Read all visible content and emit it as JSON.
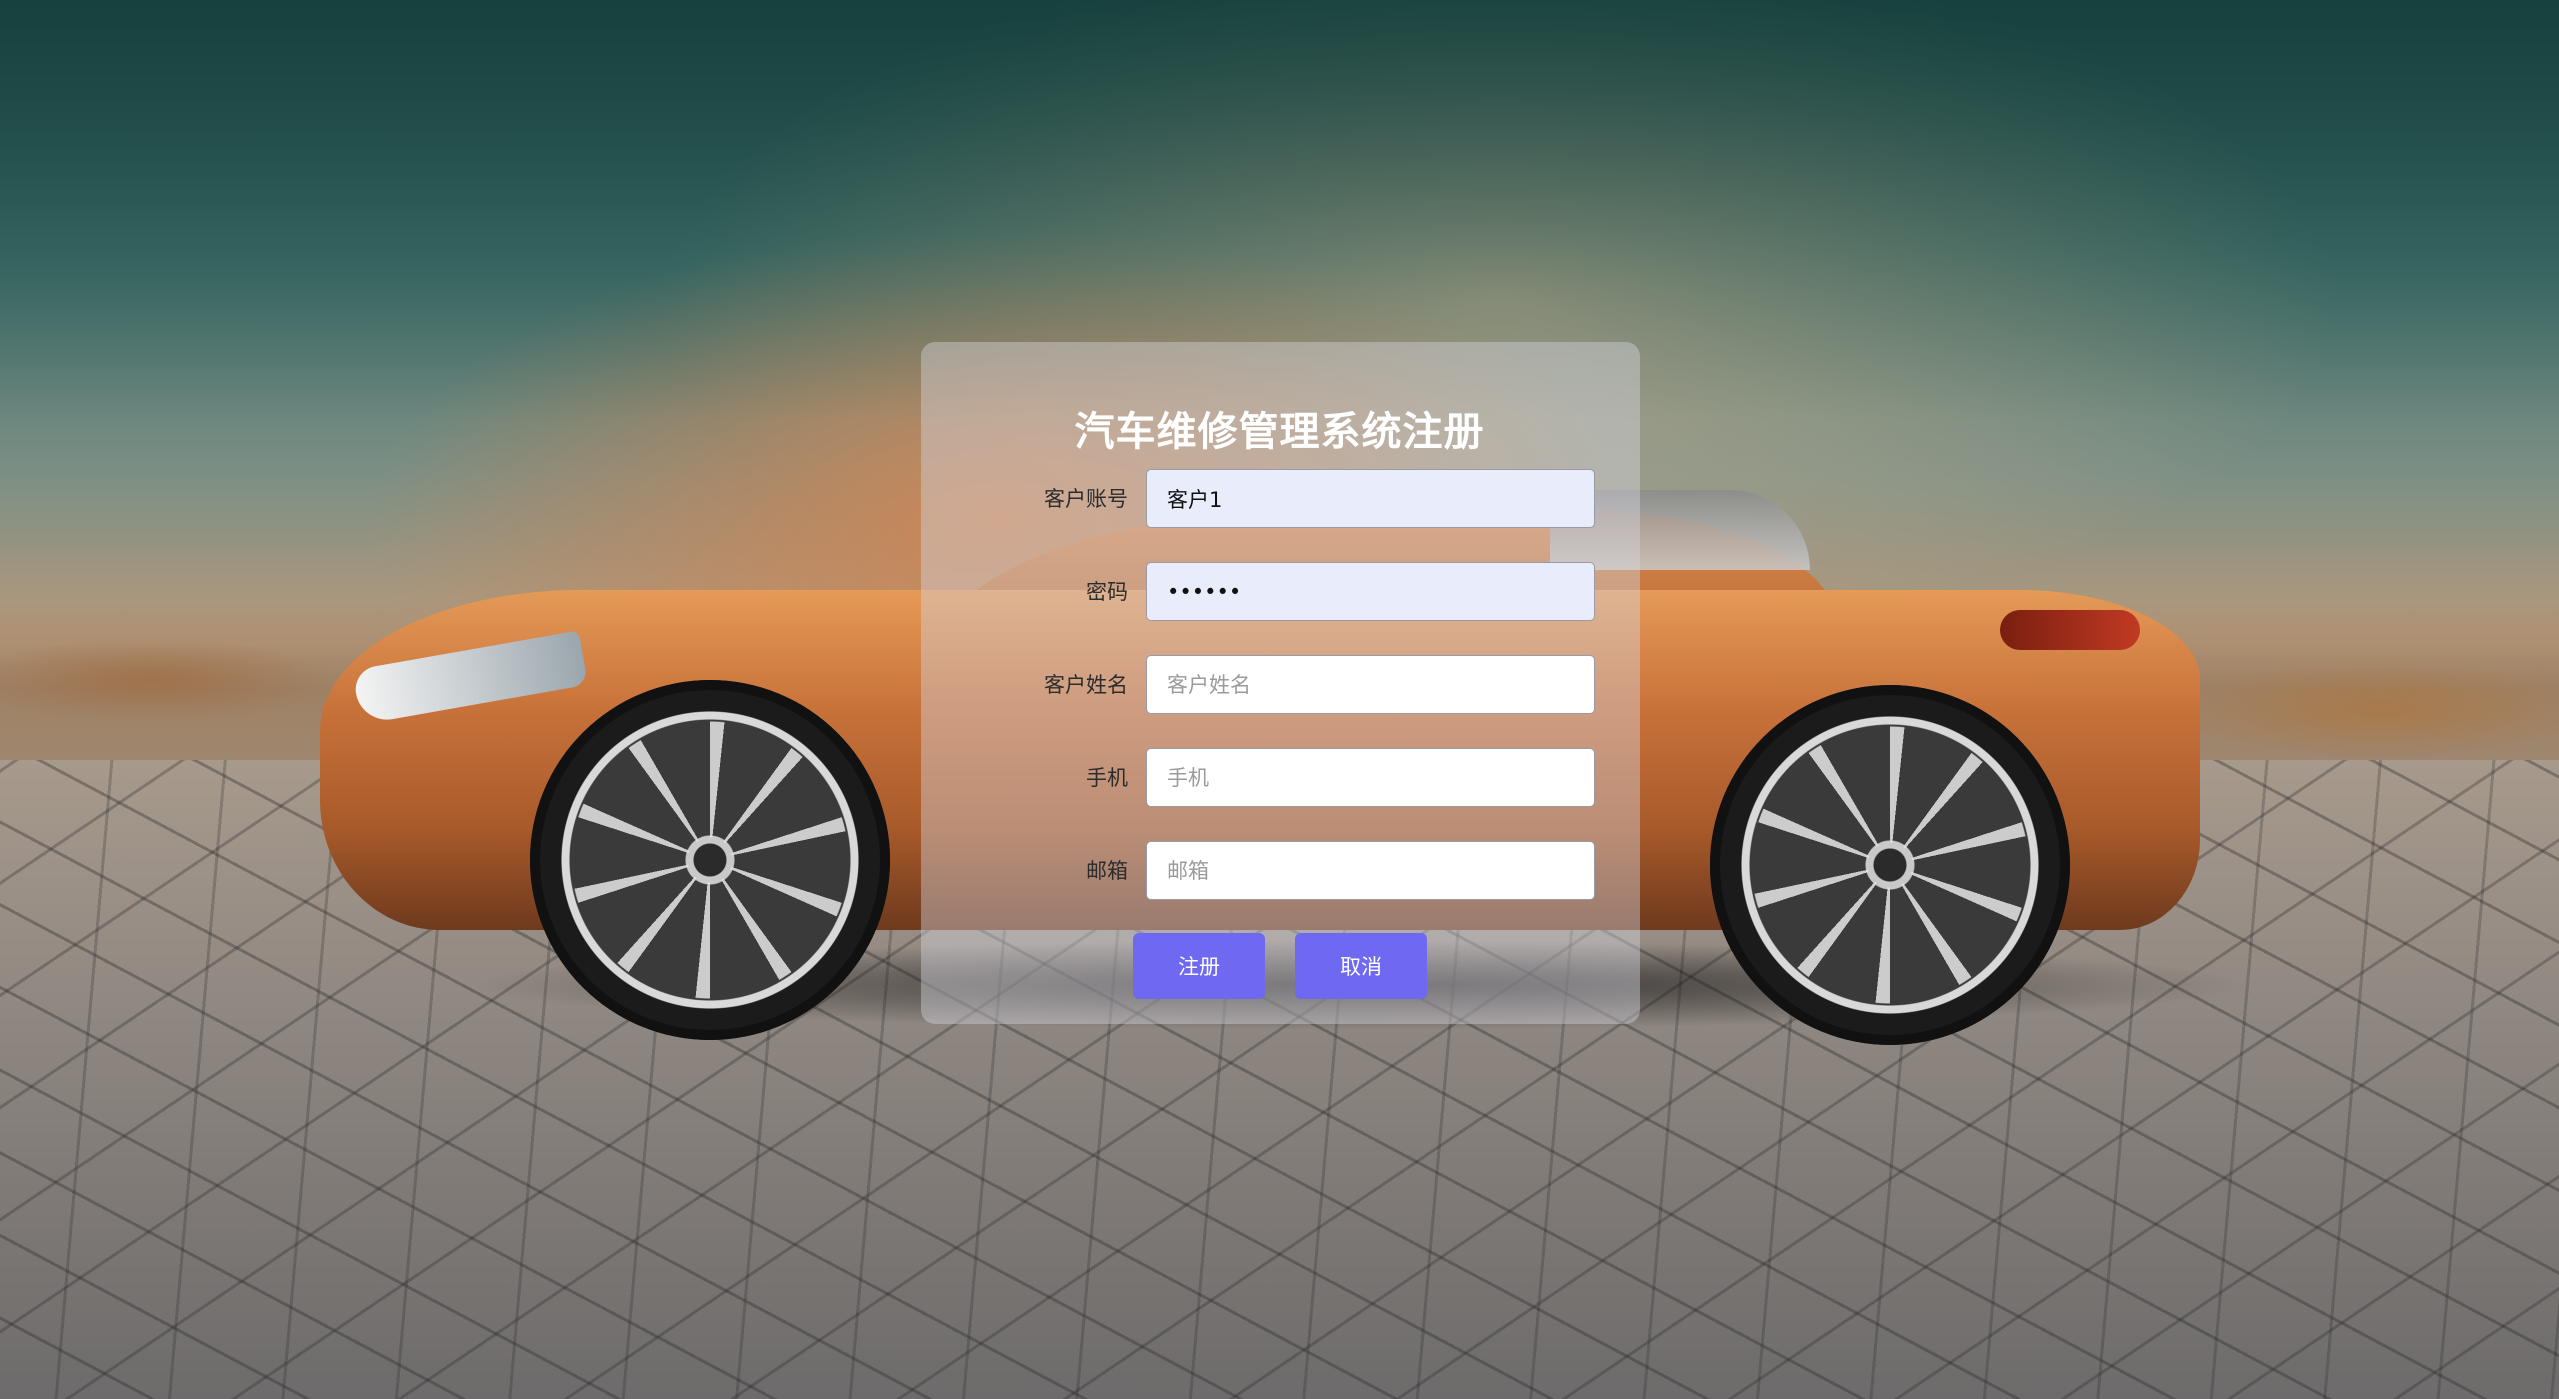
{
  "form": {
    "title": "汽车维修管理系统注册",
    "fields": [
      {
        "label": "客户账号",
        "value": "客户1",
        "placeholder": "客户账号",
        "type": "text"
      },
      {
        "label": "密码",
        "value": "123456",
        "placeholder": "密码",
        "type": "password"
      },
      {
        "label": "客户姓名",
        "value": "",
        "placeholder": "客户姓名",
        "type": "text"
      },
      {
        "label": "手机",
        "value": "",
        "placeholder": "手机",
        "type": "text"
      },
      {
        "label": "邮箱",
        "value": "",
        "placeholder": "邮箱",
        "type": "text"
      }
    ],
    "register_label": "注册",
    "cancel_label": "取消"
  },
  "colors": {
    "button": "#6f68f0",
    "autofill": "#e8ecfb",
    "panel": "rgba(215,215,225,0.42)"
  }
}
